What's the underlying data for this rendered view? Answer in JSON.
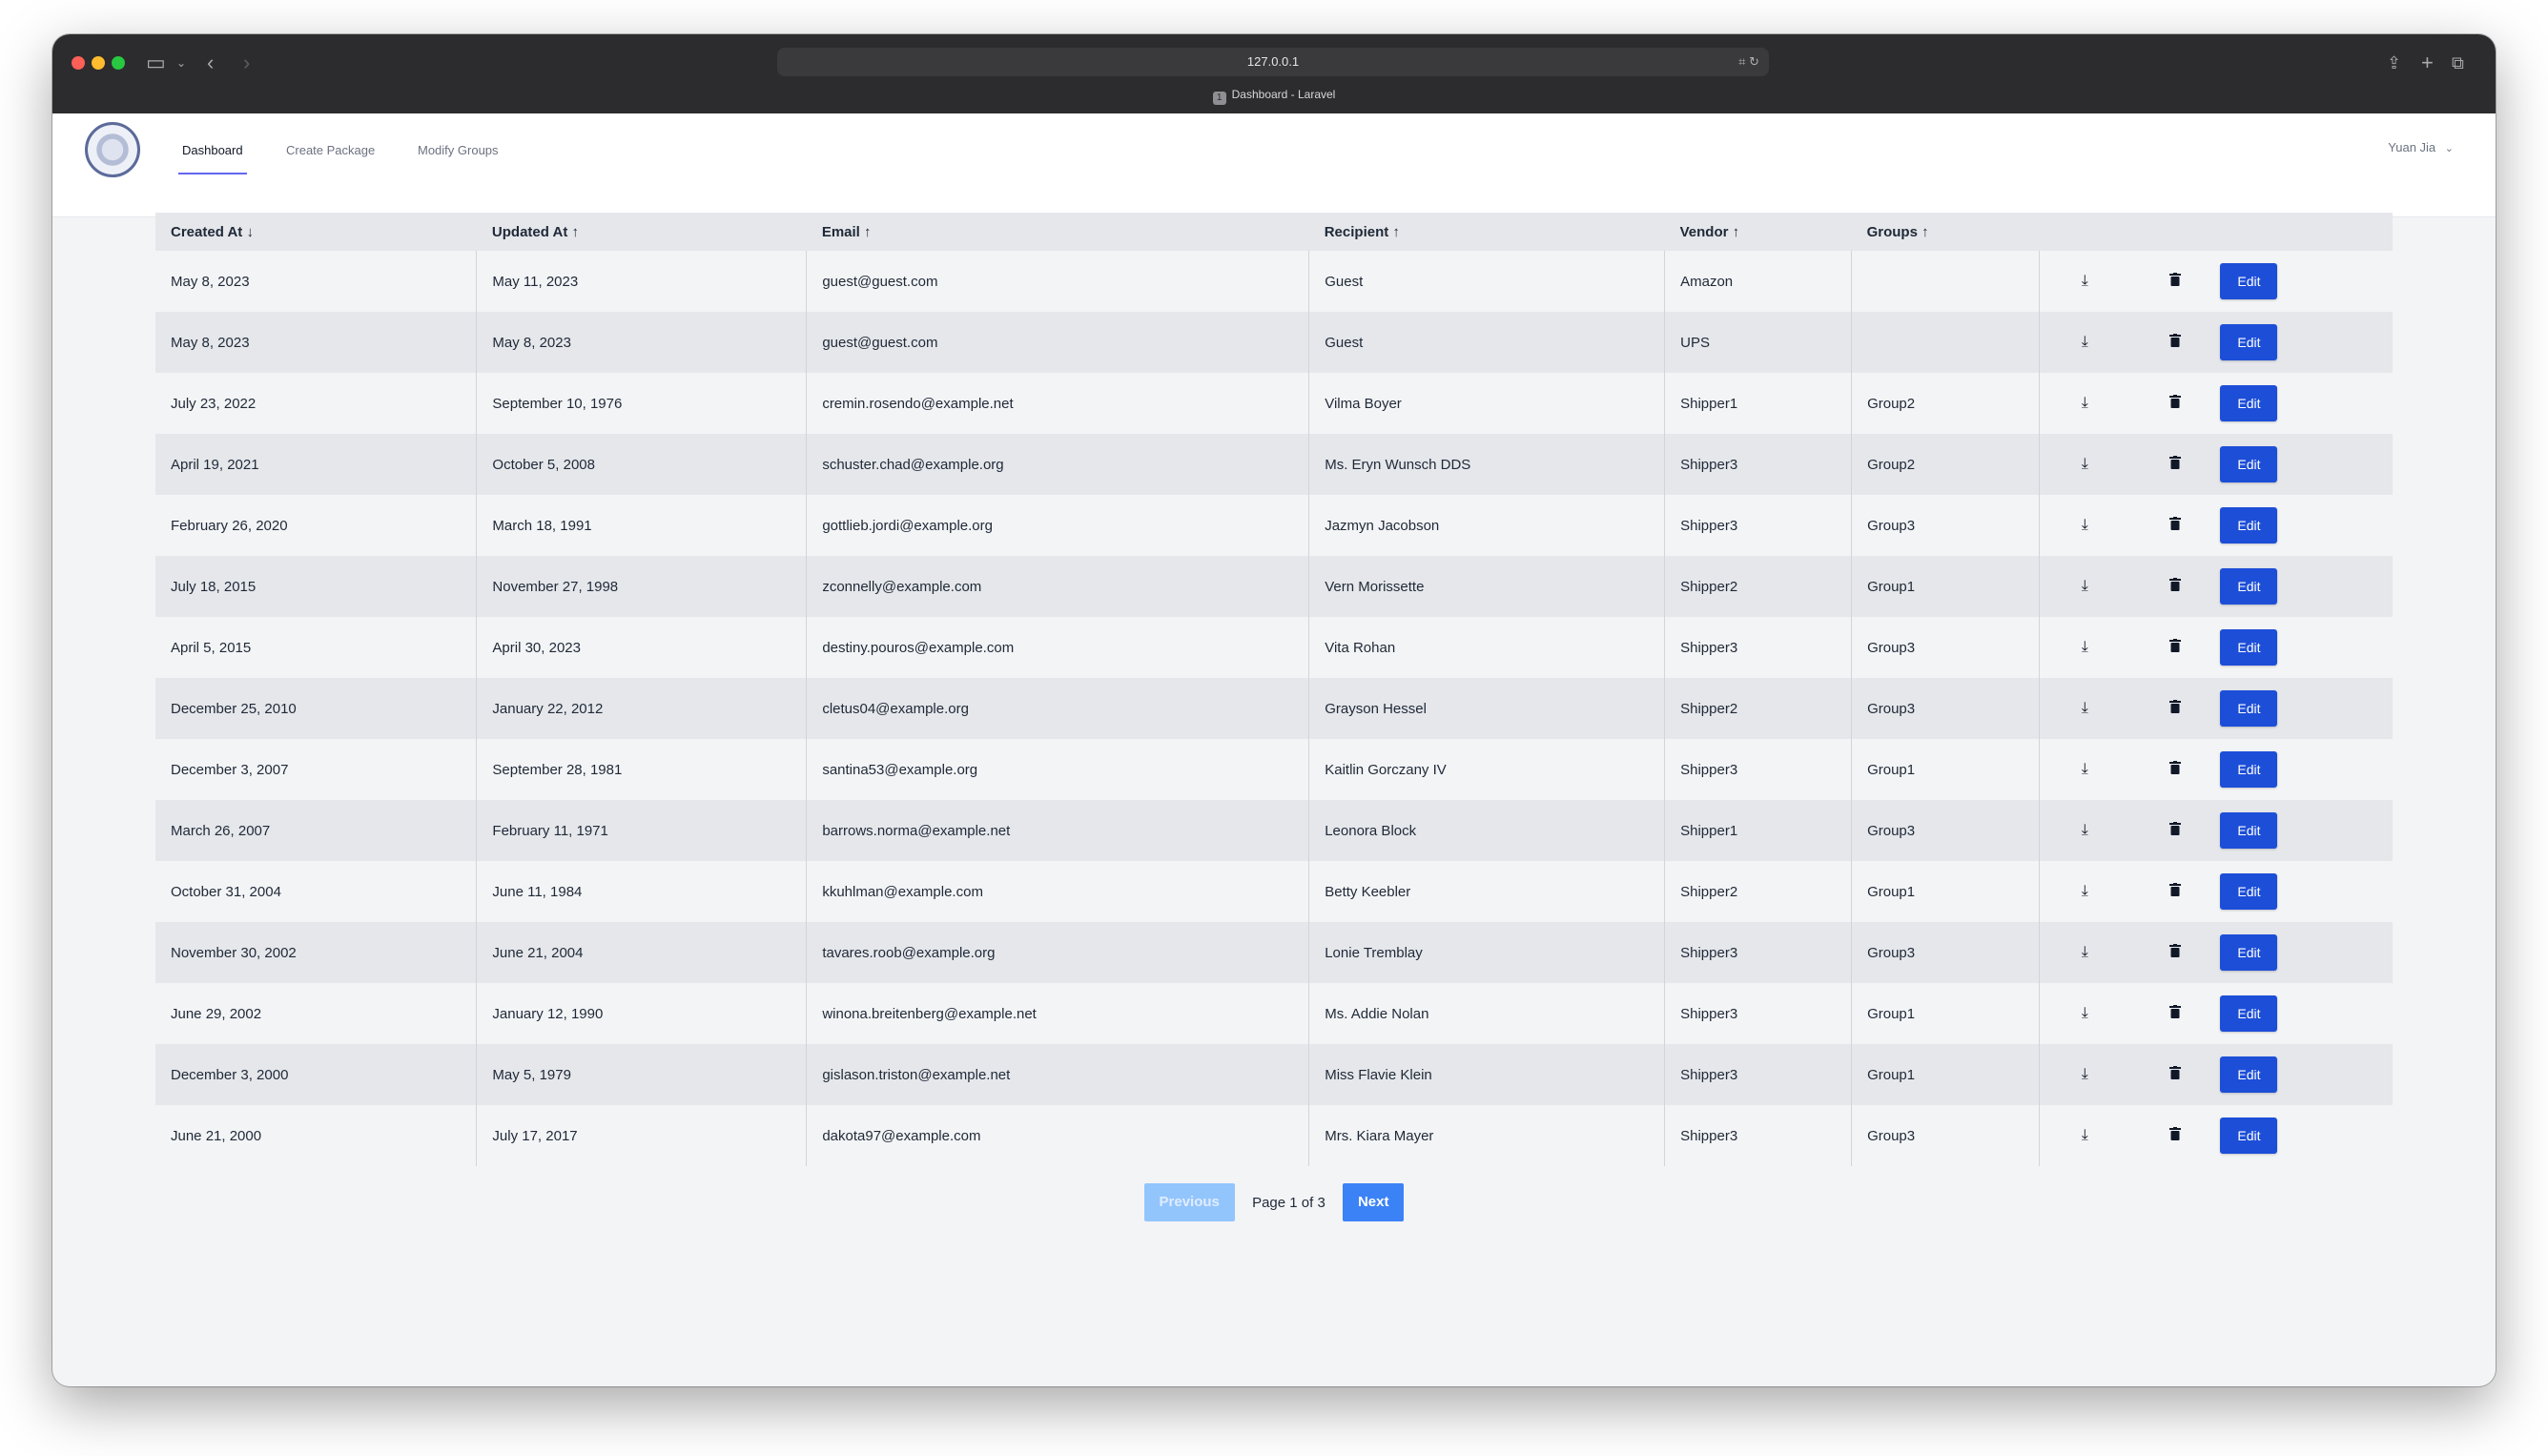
{
  "browser": {
    "url": "127.0.0.1",
    "tab_title": "Dashboard - Laravel",
    "tab_badge": "1"
  },
  "nav": {
    "links": [
      "Dashboard",
      "Create Package",
      "Modify Groups"
    ],
    "user": "Yuan Jia"
  },
  "table": {
    "headers": [
      "Created At ↓",
      "Updated At ↑",
      "Email ↑",
      "Recipient ↑",
      "Vendor ↑",
      "Groups ↑"
    ],
    "edit_label": "Edit",
    "rows": [
      [
        "May 8, 2023",
        "May 11, 2023",
        "guest@guest.com",
        "Guest",
        "Amazon",
        ""
      ],
      [
        "May 8, 2023",
        "May 8, 2023",
        "guest@guest.com",
        "Guest",
        "UPS",
        ""
      ],
      [
        "July 23, 2022",
        "September 10, 1976",
        "cremin.rosendo@example.net",
        "Vilma Boyer",
        "Shipper1",
        "Group2"
      ],
      [
        "April 19, 2021",
        "October 5, 2008",
        "schuster.chad@example.org",
        "Ms. Eryn Wunsch DDS",
        "Shipper3",
        "Group2"
      ],
      [
        "February 26, 2020",
        "March 18, 1991",
        "gottlieb.jordi@example.org",
        "Jazmyn Jacobson",
        "Shipper3",
        "Group3"
      ],
      [
        "July 18, 2015",
        "November 27, 1998",
        "zconnelly@example.com",
        "Vern Morissette",
        "Shipper2",
        "Group1"
      ],
      [
        "April 5, 2015",
        "April 30, 2023",
        "destiny.pouros@example.com",
        "Vita Rohan",
        "Shipper3",
        "Group3"
      ],
      [
        "December 25, 2010",
        "January 22, 2012",
        "cletus04@example.org",
        "Grayson Hessel",
        "Shipper2",
        "Group3"
      ],
      [
        "December 3, 2007",
        "September 28, 1981",
        "santina53@example.org",
        "Kaitlin Gorczany IV",
        "Shipper3",
        "Group1"
      ],
      [
        "March 26, 2007",
        "February 11, 1971",
        "barrows.norma@example.net",
        "Leonora Block",
        "Shipper1",
        "Group3"
      ],
      [
        "October 31, 2004",
        "June 11, 1984",
        "kkuhlman@example.com",
        "Betty Keebler",
        "Shipper2",
        "Group1"
      ],
      [
        "November 30, 2002",
        "June 21, 2004",
        "tavares.roob@example.org",
        "Lonie Tremblay",
        "Shipper3",
        "Group3"
      ],
      [
        "June 29, 2002",
        "January 12, 1990",
        "winona.breitenberg@example.net",
        "Ms. Addie Nolan",
        "Shipper3",
        "Group1"
      ],
      [
        "December 3, 2000",
        "May 5, 1979",
        "gislason.triston@example.net",
        "Miss Flavie Klein",
        "Shipper3",
        "Group1"
      ],
      [
        "June 21, 2000",
        "July 17, 2017",
        "dakota97@example.com",
        "Mrs. Kiara Mayer",
        "Shipper3",
        "Group3"
      ]
    ]
  },
  "pagination": {
    "previous": "Previous",
    "page_text": "Page 1 of 3",
    "next": "Next"
  },
  "colors": {
    "accent": "#1d4ed8",
    "next_button": "#3b82f6",
    "previous_disabled": "#93c5fd"
  }
}
